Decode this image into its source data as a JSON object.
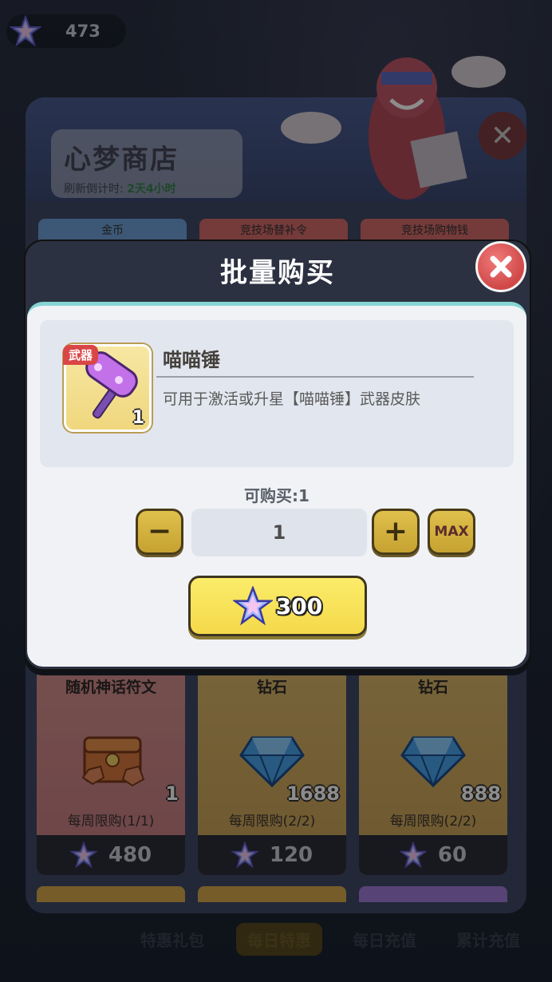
{
  "currency": {
    "amount": "473",
    "icon": "star-crystal-icon"
  },
  "shop": {
    "title": "心梦商店",
    "refresh_label": "刷新倒计时:",
    "refresh_value": "2天4小时",
    "tabs": [
      {
        "label": "金币"
      },
      {
        "label": "竞技场替补令"
      },
      {
        "label": "竞技场购物钱"
      }
    ],
    "cards": [
      {
        "title": "随机神话符文",
        "qty": "1",
        "limit": "每周限购(1/1)",
        "price": "480"
      },
      {
        "title": "钻石",
        "qty": "1688",
        "limit": "每周限购(2/2)",
        "price": "120"
      },
      {
        "title": "钻石",
        "qty": "888",
        "limit": "每周限购(2/2)",
        "price": "60"
      }
    ]
  },
  "bottom_nav": [
    {
      "label": "特惠礼包"
    },
    {
      "label": "每日特惠"
    },
    {
      "label": "每日充值"
    },
    {
      "label": "累计充值"
    }
  ],
  "modal": {
    "title": "批量购买",
    "item": {
      "tag": "武器",
      "name": "喵喵锤",
      "count": "1",
      "description": "可用于激活或升星【喵喵锤】武器皮肤"
    },
    "can_buy": "可购买:1",
    "quantity": "1",
    "max_label": "MAX",
    "minus_label": "−",
    "plus_label": "+",
    "price": "300"
  },
  "colors": {
    "buy_button": "#f4d94a",
    "stepper_button": "#d6b43e",
    "close_button": "#d94646",
    "accent_border": "#86d5d4"
  }
}
